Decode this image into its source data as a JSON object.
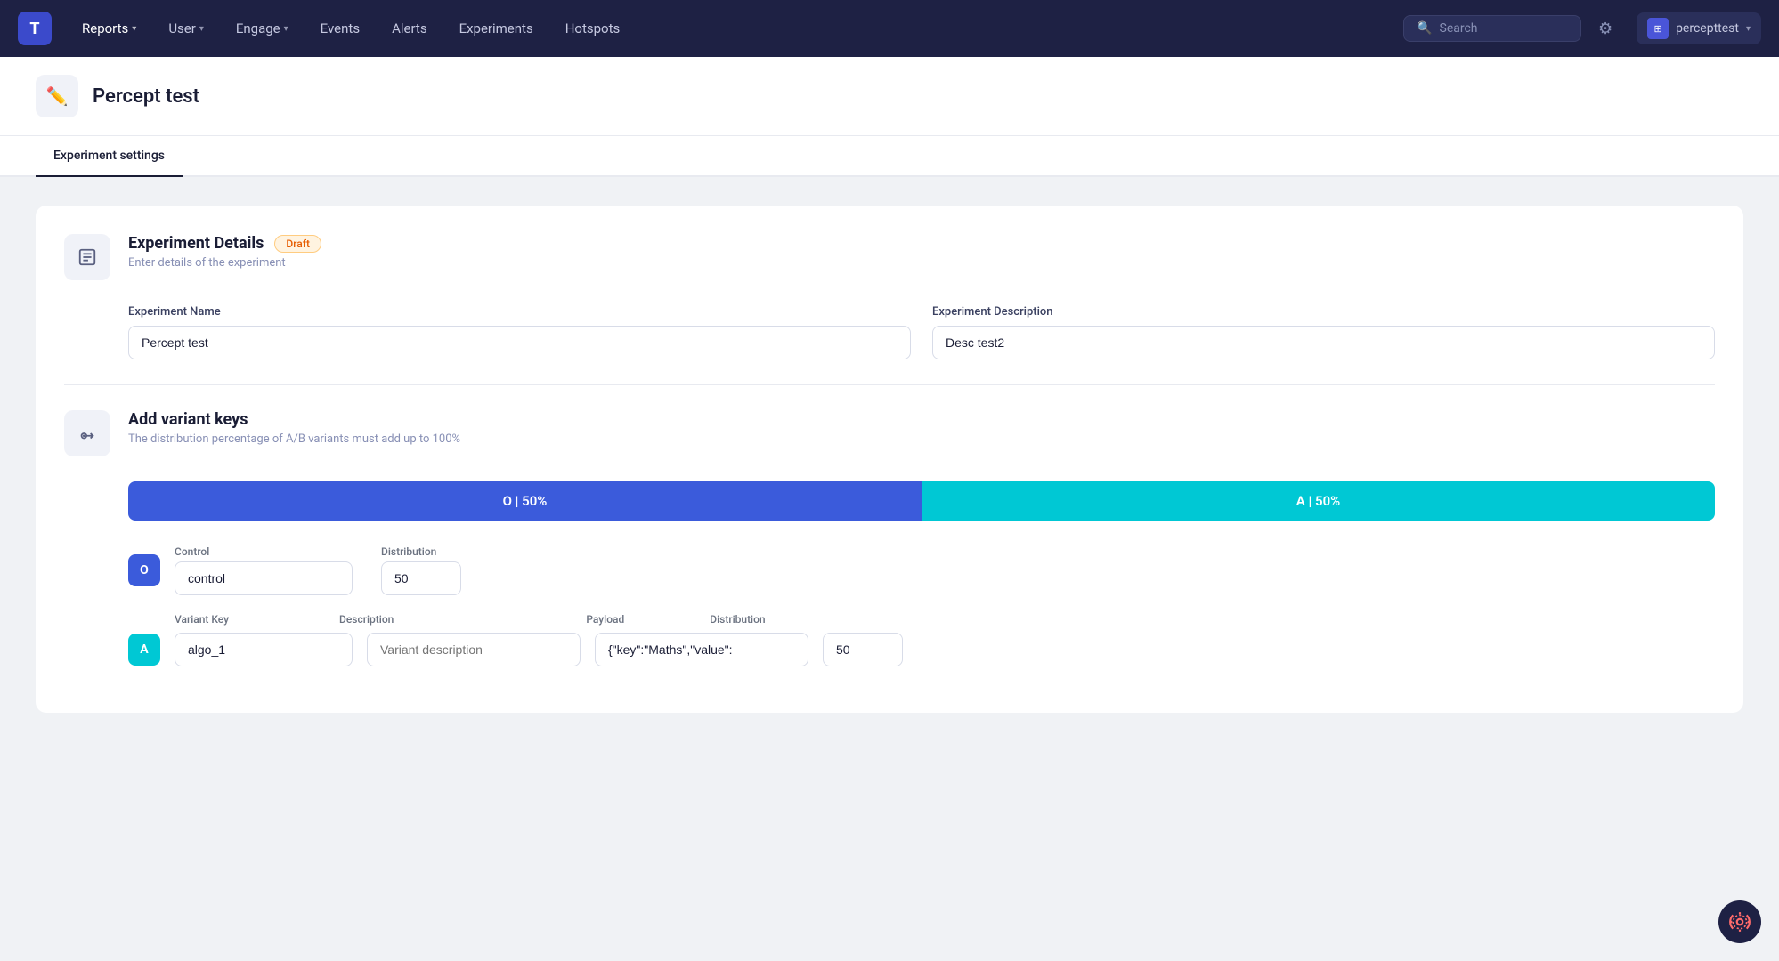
{
  "app": {
    "logo": "T"
  },
  "navbar": {
    "items": [
      {
        "label": "Reports",
        "hasDropdown": true,
        "active": false
      },
      {
        "label": "User",
        "hasDropdown": true,
        "active": false
      },
      {
        "label": "Engage",
        "hasDropdown": true,
        "active": false
      },
      {
        "label": "Events",
        "hasDropdown": false,
        "active": false
      },
      {
        "label": "Alerts",
        "hasDropdown": false,
        "active": false
      },
      {
        "label": "Experiments",
        "hasDropdown": false,
        "active": true
      },
      {
        "label": "Hotspots",
        "hasDropdown": false,
        "active": false
      }
    ],
    "search_placeholder": "Search",
    "account_label": "percepttest",
    "account_icon": "⊞"
  },
  "page": {
    "title": "Percept test",
    "edit_icon": "✏️"
  },
  "tabs": [
    {
      "label": "Experiment settings",
      "active": true
    }
  ],
  "experiment_details": {
    "section_title": "Experiment Details",
    "badge": "Draft",
    "subtitle": "Enter details of the experiment",
    "name_label": "Experiment Name",
    "name_value": "Percept test",
    "name_placeholder": "Experiment Name",
    "description_label": "Experiment Description",
    "description_value": "Desc test2",
    "description_placeholder": "Experiment Description"
  },
  "variant_keys": {
    "section_title": "Add variant keys",
    "subtitle": "The distribution percentage of A/B variants must add up to 100%",
    "bar_o_label": "O | 50%",
    "bar_a_label": "A | 50%",
    "control_label": "Control",
    "distribution_label": "Distribution",
    "control_badge": "O",
    "control_value": "control",
    "control_distribution": "50",
    "variant_label": "Variant Key",
    "variant_desc_label": "Description",
    "variant_payload_label": "Payload",
    "variant_distribution_label": "Distribution",
    "variant_badge": "A",
    "variant_key_value": "algo_1",
    "variant_desc_placeholder": "Variant description",
    "variant_payload_value": "{\"key\":\"Maths\",\"value\":",
    "variant_distribution": "50"
  },
  "bottom_icon": "⚙️"
}
